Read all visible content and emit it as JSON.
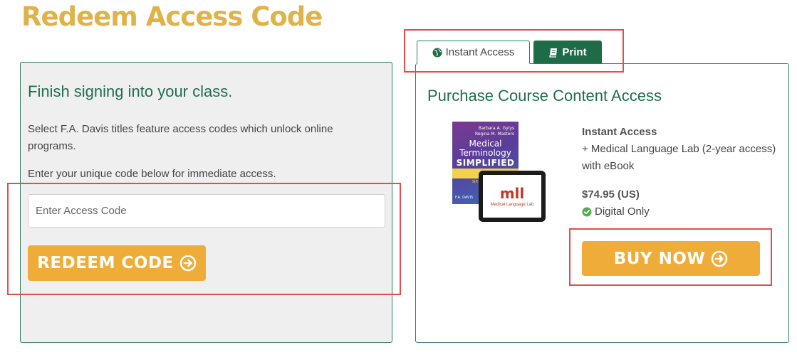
{
  "page": {
    "title": "Redeem Access Code"
  },
  "redeem": {
    "heading": "Finish signing into your class.",
    "description": "Select F.A. Davis titles feature access codes which unlock online programs.",
    "instruction": "Enter your unique code below for immediate access.",
    "input_placeholder": "Enter Access Code",
    "input_value": "",
    "button_label": "REDEEM CODE"
  },
  "tabs": [
    {
      "label": "Instant Access",
      "icon": "globe-icon",
      "active": true
    },
    {
      "label": "Print",
      "icon": "book-icon",
      "active": false
    }
  ],
  "purchase": {
    "heading": "Purchase Course Content Access",
    "product_name": "Instant Access",
    "product_detail": "+ Medical Language Lab (2-year access) with eBook",
    "price": "$74.95 (US)",
    "availability": "Digital Only",
    "button_label": "BUY NOW",
    "cover": {
      "authors": [
        "Barbara A. Gylys",
        "Regina M. Masters"
      ],
      "title_line1": "Medical",
      "title_line2": "Terminology",
      "title_line3": "SIMPLIFIED",
      "edition": "SIXTH EDITION",
      "publisher": "F.A. DAVIS"
    },
    "tablet": {
      "logo": "mll",
      "caption": "Medical Language Lab"
    }
  },
  "colors": {
    "title": "#e0b24a",
    "accent_green": "#1e6b47",
    "button_yellow": "#f0ac38",
    "highlight_red": "#e34d4d",
    "check_green": "#4cae4c"
  }
}
